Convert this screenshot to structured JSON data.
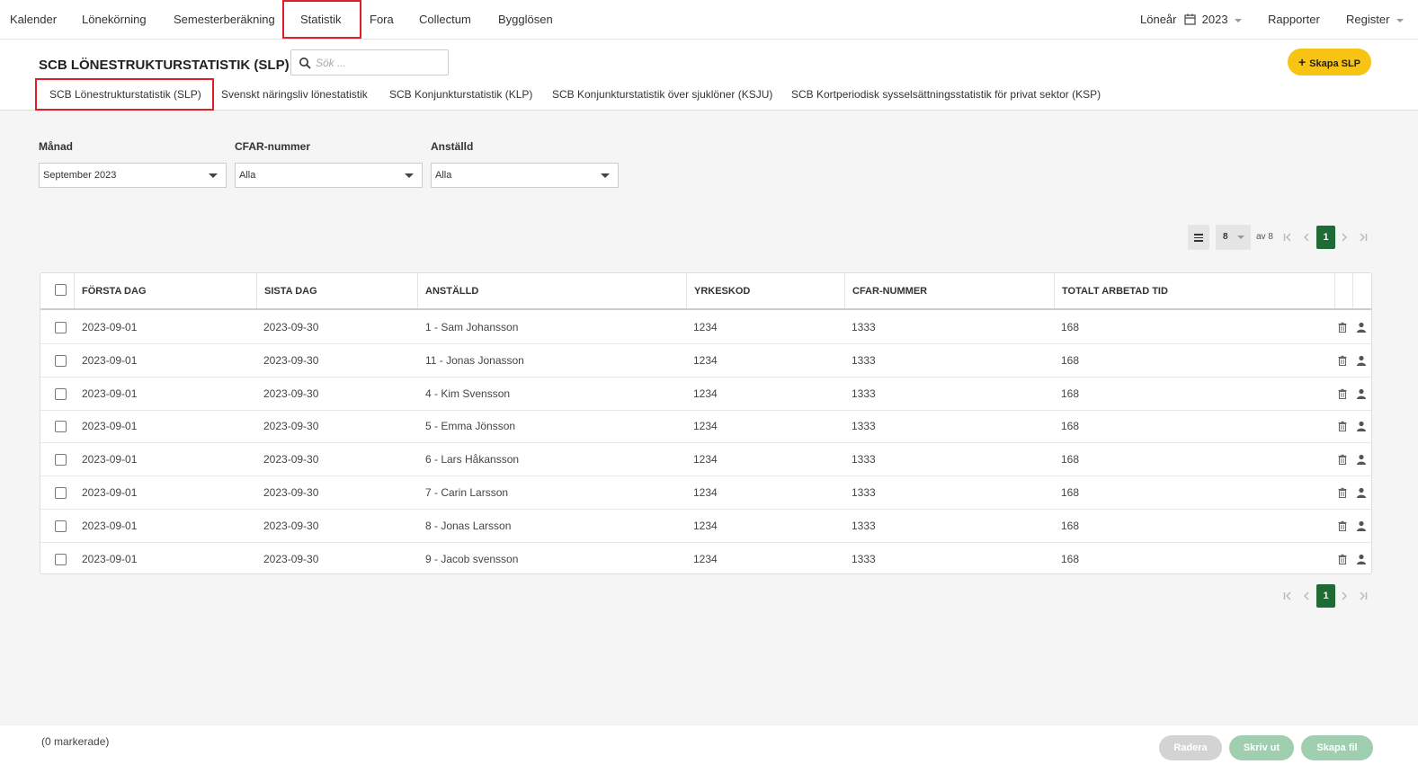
{
  "topnav": {
    "left_items": [
      "Kalender",
      "Lönekörning",
      "Semesterberäkning",
      "Statistik",
      "Fora",
      "Collectum",
      "Bygglösen"
    ],
    "active": "Statistik",
    "year_label": "Löneår",
    "year_value": "2023",
    "reports": "Rapporter",
    "register": "Register"
  },
  "header": {
    "title": "SCB LÖNESTRUKTURSTATISTIK (SLP)",
    "search_placeholder": "Sök ...",
    "create_button": "Skapa SLP",
    "tabs": [
      "SCB Lönestrukturstatistik (SLP)",
      "Svenskt näringsliv lönestatistik",
      "SCB Konjunkturstatistik (KLP)",
      "SCB Konjunkturstatistik över sjuklöner (KSJU)",
      "SCB Kortperiodisk sysselsättningsstatistik för privat sektor (KSP)"
    ],
    "active_tab": 0
  },
  "filters": {
    "month": {
      "label": "Månad",
      "value": "September 2023"
    },
    "cfar": {
      "label": "CFAR-nummer",
      "value": "Alla"
    },
    "employee": {
      "label": "Anställd",
      "value": "Alla"
    }
  },
  "pagination": {
    "per_page": "8",
    "of_text": "av 8",
    "current_page": "1"
  },
  "table": {
    "columns": [
      "FÖRSTA DAG",
      "SISTA DAG",
      "ANSTÄLLD",
      "YRKESKOD",
      "CFAR-NUMMER",
      "TOTALT ARBETAD TID"
    ],
    "rows": [
      [
        "2023-09-01",
        "2023-09-30",
        "1 - Sam Johansson",
        "1234",
        "1333",
        "168"
      ],
      [
        "2023-09-01",
        "2023-09-30",
        "11 - Jonas Jonasson",
        "1234",
        "1333",
        "168"
      ],
      [
        "2023-09-01",
        "2023-09-30",
        "4 - Kim Svensson",
        "1234",
        "1333",
        "168"
      ],
      [
        "2023-09-01",
        "2023-09-30",
        "5 - Emma Jönsson",
        "1234",
        "1333",
        "168"
      ],
      [
        "2023-09-01",
        "2023-09-30",
        "6 - Lars Håkansson",
        "1234",
        "1333",
        "168"
      ],
      [
        "2023-09-01",
        "2023-09-30",
        "7 - Carin Larsson",
        "1234",
        "1333",
        "168"
      ],
      [
        "2023-09-01",
        "2023-09-30",
        "8 - Jonas Larsson",
        "1234",
        "1333",
        "168"
      ],
      [
        "2023-09-01",
        "2023-09-30",
        "9 - Jacob svensson",
        "1234",
        "1333",
        "168"
      ]
    ],
    "row_icons": [
      "trash-icon",
      "user-icon"
    ]
  },
  "footer": {
    "marked": "(0 markerade)",
    "delete": "Radera",
    "print": "Skriv ut",
    "create_file": "Skapa fil"
  },
  "colors": {
    "accent_yellow": "#f7c413",
    "page_green": "#1f6b35",
    "highlight_red": "#e01f26",
    "button_grey": "#d3d3d3",
    "button_green": "#9fcfae"
  }
}
